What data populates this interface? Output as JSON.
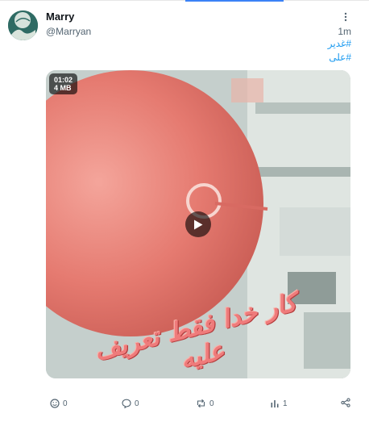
{
  "post": {
    "author_name": "Marry",
    "author_handle": "@Marryan",
    "timestamp": "1m",
    "hashtags": [
      "#غدیر",
      "#علی"
    ]
  },
  "media": {
    "duration": "01:02",
    "size": "4 MB",
    "overlay_caption": "کار خدا فقط تعریف علیه",
    "has_play_button": true
  },
  "actions": {
    "reactions_count": "0",
    "replies_count": "0",
    "reposts_count": "0",
    "views_count": "1"
  },
  "icons": [
    "more-vertical-icon",
    "emoji-icon",
    "reply-icon",
    "repost-icon",
    "views-icon",
    "share-icon",
    "play-icon"
  ],
  "colors": {
    "link": "#1d9bf0",
    "muted": "#536471",
    "top_accent": "#3b82f6",
    "video_tint": "#e0736a"
  }
}
